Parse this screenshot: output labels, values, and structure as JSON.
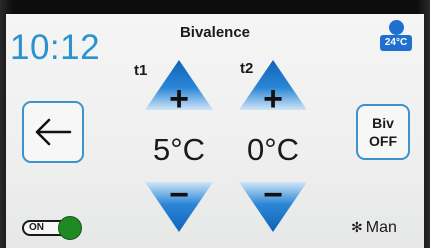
{
  "header": {
    "clock": "10:12",
    "title": "Bivalence",
    "outdoor_temp": "24°C"
  },
  "zones": [
    {
      "label": "t1",
      "value": "5°C",
      "increase_symbol": "+",
      "decrease_symbol": "−"
    },
    {
      "label": "t2",
      "value": "0°C",
      "increase_symbol": "+",
      "decrease_symbol": "−"
    }
  ],
  "controls": {
    "back_icon": "arrow-left-icon",
    "biv_line1": "Biv",
    "biv_line2": "OFF",
    "toggle_label": "ON",
    "toggle_state": "on",
    "mode_icon": "fan-icon",
    "mode_label": "Man"
  },
  "colors": {
    "accent": "#2a93cf",
    "arrow_blue": "#2b86d6",
    "toggle_green": "#1f8a24",
    "badge_blue": "#1e6fd0"
  }
}
